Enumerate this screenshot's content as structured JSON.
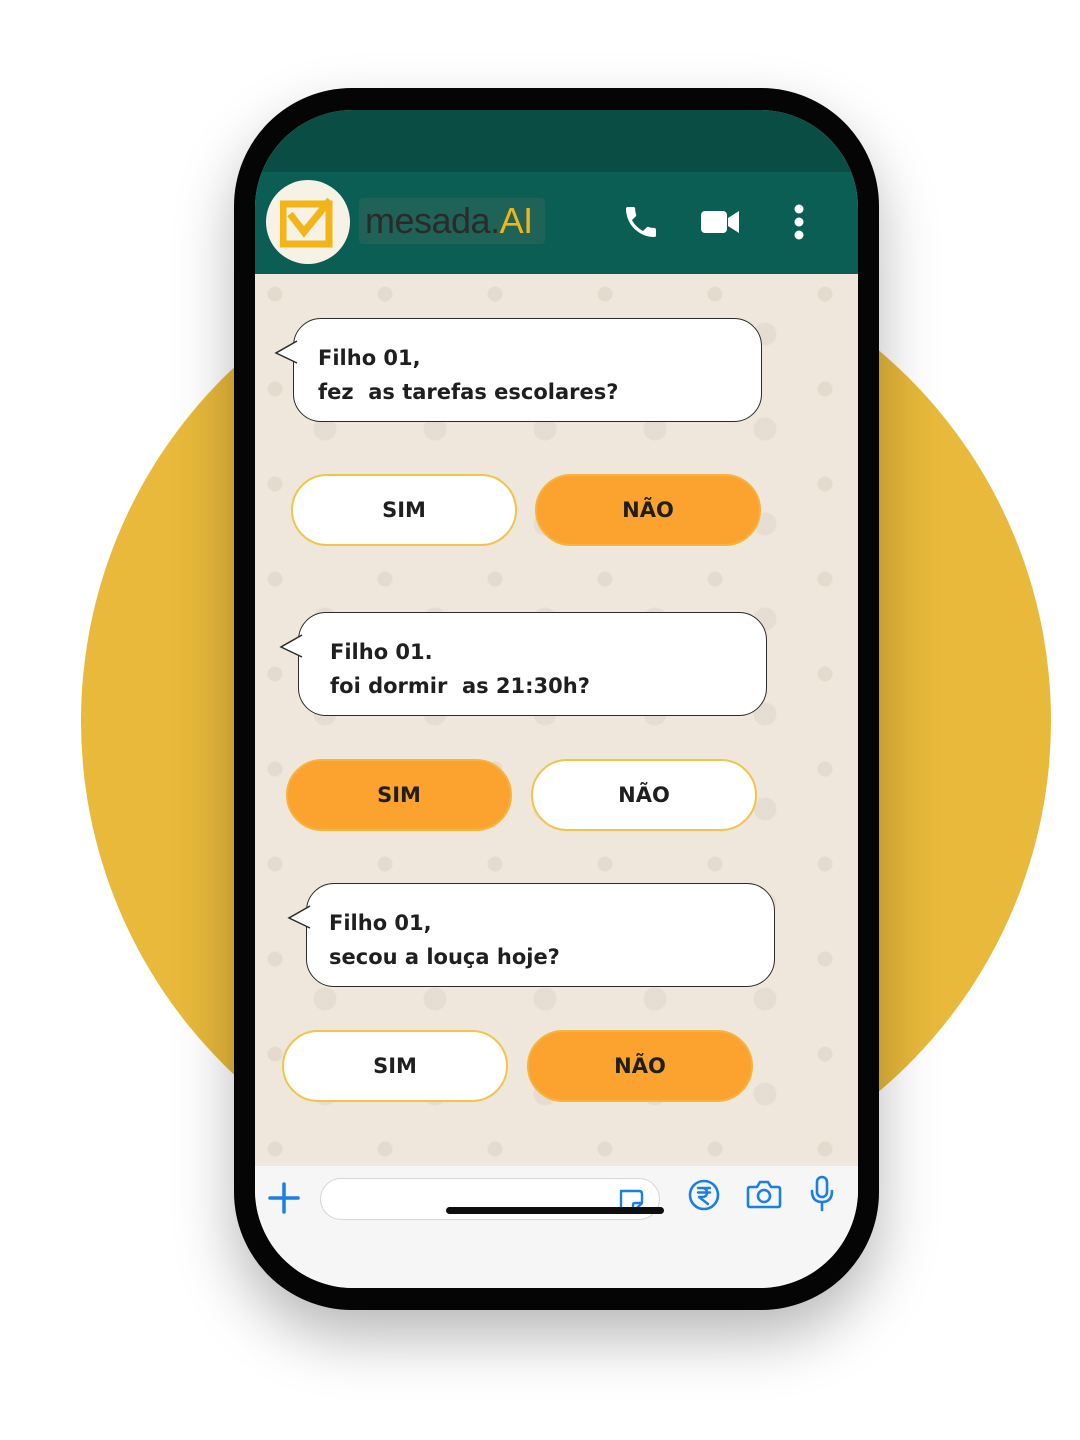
{
  "header": {
    "brand_name": "mesada.",
    "brand_suffix": "AI",
    "icons": [
      "phone-icon",
      "video-camera-icon",
      "more-options-icon"
    ]
  },
  "chat": {
    "messages": [
      {
        "lines": [
          "Filho 01,",
          "fez  as tarefas escolares?"
        ],
        "options": [
          {
            "label": "SIM",
            "selected": false
          },
          {
            "label": "NÃO",
            "selected": true
          }
        ]
      },
      {
        "lines": [
          "Filho 01.",
          "foi dormir  as 21:30h?"
        ],
        "options": [
          {
            "label": "SIM",
            "selected": true
          },
          {
            "label": "NÃO",
            "selected": false
          }
        ]
      },
      {
        "lines": [
          "Filho 01,",
          "secou a louça hoje?"
        ],
        "options": [
          {
            "label": "SIM",
            "selected": false
          },
          {
            "label": "NÃO",
            "selected": true
          }
        ]
      }
    ]
  },
  "input_bar": {
    "icons": [
      "plus-icon",
      "sticker-icon",
      "rupee-payment-icon",
      "camera-icon",
      "microphone-icon"
    ]
  },
  "colors": {
    "header": "#0B5E54",
    "accent_yellow": "#E8B93A",
    "button_selected": "#FCA22F",
    "icon_blue": "#1A7FE6"
  }
}
